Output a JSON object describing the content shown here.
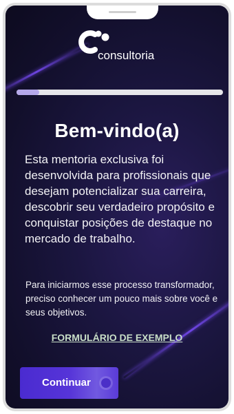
{
  "brand": {
    "logo_text": "consultoria"
  },
  "onboarding": {
    "progress_fraction": 0.11,
    "title": "Bem-vindo(a)",
    "intro_text": "Esta mentoria exclusiva foi desenvolvida para profissionais que desejam potencializar sua carreira, descobrir seu verdadeiro propósito e conquistar posições de destaque no mercado de trabalho.",
    "sub_text": "Para iniciarmos esse processo transformador, preciso conhecer um pouco mais sobre você e seus objetivos.",
    "form_link_label": "FORMULÁRIO DE EXEMPLO",
    "continue_button_label": "Continuar"
  },
  "colors": {
    "accent": "#5634d8",
    "progress_fill": "#b5a8ea",
    "link": "#c9dfc8",
    "background": "#1b1640"
  }
}
